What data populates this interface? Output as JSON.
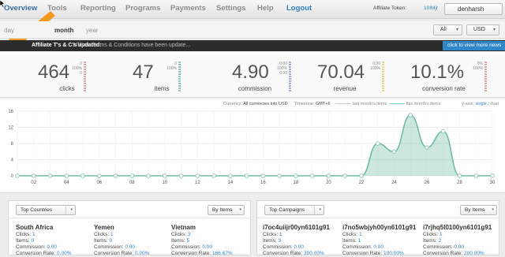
{
  "nav": {
    "items": [
      "Overview",
      "Tools",
      "Reporting",
      "Programs",
      "Payments",
      "Settings",
      "Help",
      "Logout"
    ],
    "token_label": "Affiliate Token:",
    "token_value": "10IMjr",
    "username": "denharsh"
  },
  "range": {
    "items": [
      "day",
      "month",
      "year"
    ],
    "filter_value": "All",
    "currency_value": "USD"
  },
  "alert": {
    "title": "Affiliate T's & C's updated:",
    "text": "Affiliate Terms & Conditions have been update...",
    "button": "click to view more news"
  },
  "stats": [
    {
      "value": "464",
      "label": "clicks",
      "pct_top": "0",
      "pct_mid": "100%",
      "pct_bot": "0",
      "color": "#e0a9a6"
    },
    {
      "value": "47",
      "label": "items",
      "pct_top": "0",
      "pct_mid": "100%",
      "pct_bot": "",
      "color": "#8ecdb6"
    },
    {
      "value": "4.90",
      "label": "commission",
      "pct_top": "0.00",
      "pct_mid": "100%",
      "pct_bot": "0.00",
      "color": "#a9b3d8"
    },
    {
      "value": "70.04",
      "label": "revenue",
      "pct_top": "0.00",
      "pct_mid": "100%",
      "pct_bot": "",
      "color": "#e3d79a"
    },
    {
      "value": "10.1%",
      "label": "conversion rate",
      "pct_top": "0%",
      "pct_mid": "100%",
      "pct_bot": "",
      "color": "#e0a9a6"
    }
  ],
  "chart_meta": {
    "currency_label": "Currency:",
    "currency_value": "All currencies into USD",
    "timezone_label": "Timezone:",
    "timezone_value": "GMT+6",
    "last_legend": "last month's items",
    "this_legend": "this month's items",
    "yaxis_label": "y-axis:",
    "yaxis_single": "single",
    "yaxis_sep": "/",
    "yaxis_dual": "dual"
  },
  "chart_data": {
    "type": "area",
    "x": [
      1,
      2,
      3,
      4,
      5,
      6,
      7,
      8,
      9,
      10,
      11,
      12,
      13,
      14,
      15,
      16,
      17,
      18,
      19,
      20,
      21,
      22,
      23,
      24,
      25,
      26,
      27,
      28,
      29,
      30
    ],
    "x_ticks": [
      "02",
      "04",
      "06",
      "08",
      "10",
      "12",
      "14",
      "16",
      "18",
      "20",
      "22",
      "24",
      "26",
      "28",
      "30"
    ],
    "series": [
      {
        "name": "this month's items",
        "values": [
          0,
          0,
          0,
          0,
          0,
          0,
          0,
          0,
          0,
          0,
          0,
          0,
          0,
          0,
          0,
          0,
          0,
          0,
          0,
          0,
          0,
          0,
          8,
          6,
          15,
          7,
          11,
          0,
          0,
          0
        ],
        "color": "#8ecdb6"
      }
    ],
    "yticks": [
      0,
      4,
      8,
      12,
      16
    ],
    "ylim": [
      0,
      16
    ],
    "grid": true
  },
  "panels": {
    "left": {
      "select": "Top Countries",
      "sort": "By Items",
      "entries": [
        {
          "name": "South Africa",
          "clicks_label": "Clicks:",
          "clicks": "1",
          "items_label": "Items:",
          "items": "0",
          "commission_label": "Commission:",
          "commission": "0.00",
          "conversion_label": "Conversion Rate:",
          "conversion": "0.00%"
        },
        {
          "name": "Yemen",
          "clicks_label": "Clicks:",
          "clicks": "1",
          "items_label": "Items:",
          "items": "0",
          "commission_label": "Commission:",
          "commission": "0.00",
          "conversion_label": "Conversion Rate:",
          "conversion": "0.00%"
        },
        {
          "name": "Vietnam",
          "clicks_label": "Clicks:",
          "clicks": "3",
          "items_label": "Items:",
          "items": "5",
          "commission_label": "Commission:",
          "commission": "0.00",
          "conversion_label": "Conversion Rate:",
          "conversion": "166.67%"
        }
      ]
    },
    "right": {
      "select": "Top Campaigns",
      "sort": "By Items",
      "entries": [
        {
          "name": "i7oc4uiijr00yn6101g91",
          "clicks_label": "Clicks:",
          "clicks": "1",
          "items_label": "Items:",
          "items": "3",
          "commission_label": "Commission:",
          "commission": "0.00",
          "conversion_label": "Conversion Rate:",
          "conversion": "300.00%"
        },
        {
          "name": "i7no5wbjyh00yn6101g91",
          "clicks_label": "Clicks:",
          "clicks": "1",
          "items_label": "Items:",
          "items": "1",
          "commission_label": "Commission:",
          "commission": "0.00",
          "conversion_label": "Conversion Rate:",
          "conversion": "100.00%"
        },
        {
          "name": "i7rjhq5l0100yn6101g91",
          "clicks_label": "Clicks:",
          "clicks": "1",
          "items_label": "Items:",
          "items": "2",
          "commission_label": "Commission:",
          "commission": "0.00",
          "conversion_label": "Conversion Rate:",
          "conversion": "200.00%"
        }
      ]
    }
  }
}
